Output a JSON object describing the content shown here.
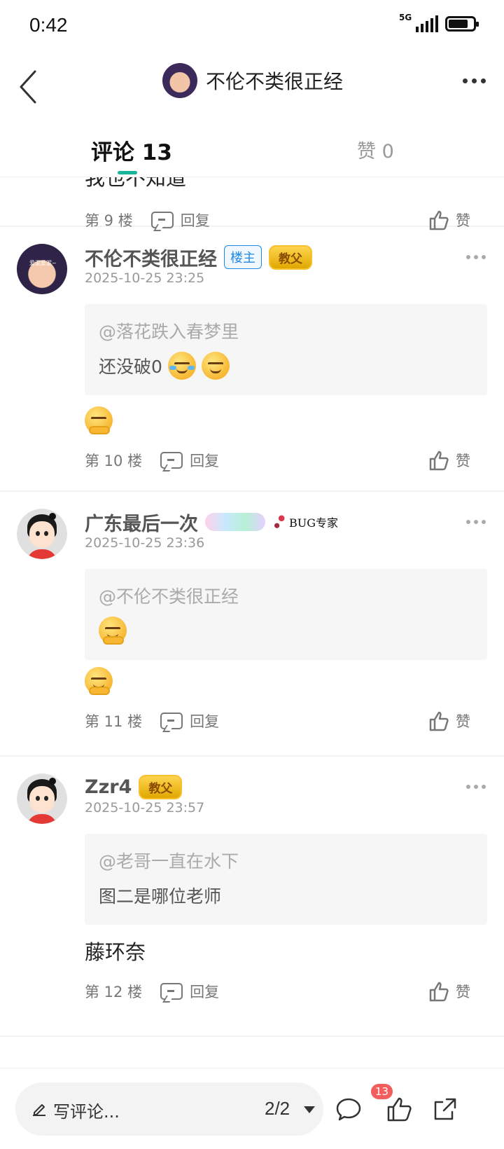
{
  "status_bar": {
    "time": "0:42",
    "network": "5G"
  },
  "nav": {
    "title": "不伦不类很正经",
    "avatar_caption": "爱泥爱泥~"
  },
  "tabs": {
    "comments": "评论 13",
    "likes": "赞 0"
  },
  "partial_comment": {
    "text": "我也不知道",
    "floor": "第 9 楼",
    "reply": "回复",
    "like": "赞"
  },
  "comments": [
    {
      "name": "不伦不类很正经",
      "badges": [
        "楼主",
        "教父"
      ],
      "time": "2025-10-25 23:25",
      "quote_at": "@落花跌入春梦里",
      "quote_text": "还没破0",
      "quote_emojis": [
        "laugh-cry-emoji",
        "laugh-cry-emoji"
      ],
      "text_emoji": "shy-hand-emoji",
      "floor": "第 10 楼",
      "reply": "回复",
      "like": "赞"
    },
    {
      "name": "广东最后一次",
      "badges": [
        "BUG专家"
      ],
      "time": "2025-10-25 23:36",
      "quote_at": "@不伦不类很正经",
      "quote_emojis": [
        "smirk-emoji"
      ],
      "text_emoji": "smirk-emoji",
      "floor": "第 11 楼",
      "reply": "回复",
      "like": "赞"
    },
    {
      "name": "Zzr4",
      "badges": [
        "教父"
      ],
      "time": "2025-10-25 23:57",
      "quote_at": "@老哥一直在水下",
      "quote_text": "图二是哪位老师",
      "text": "藤环奈",
      "floor": "第 12 楼",
      "reply": "回复",
      "like": "赞"
    }
  ],
  "bottom_bar": {
    "write_placeholder": "写评论...",
    "page": "2/2",
    "comment_count": "13"
  },
  "colors": {
    "accent": "#17b69a",
    "owner_badge": "#1e88e5",
    "count_badge": "#f25d5d"
  }
}
